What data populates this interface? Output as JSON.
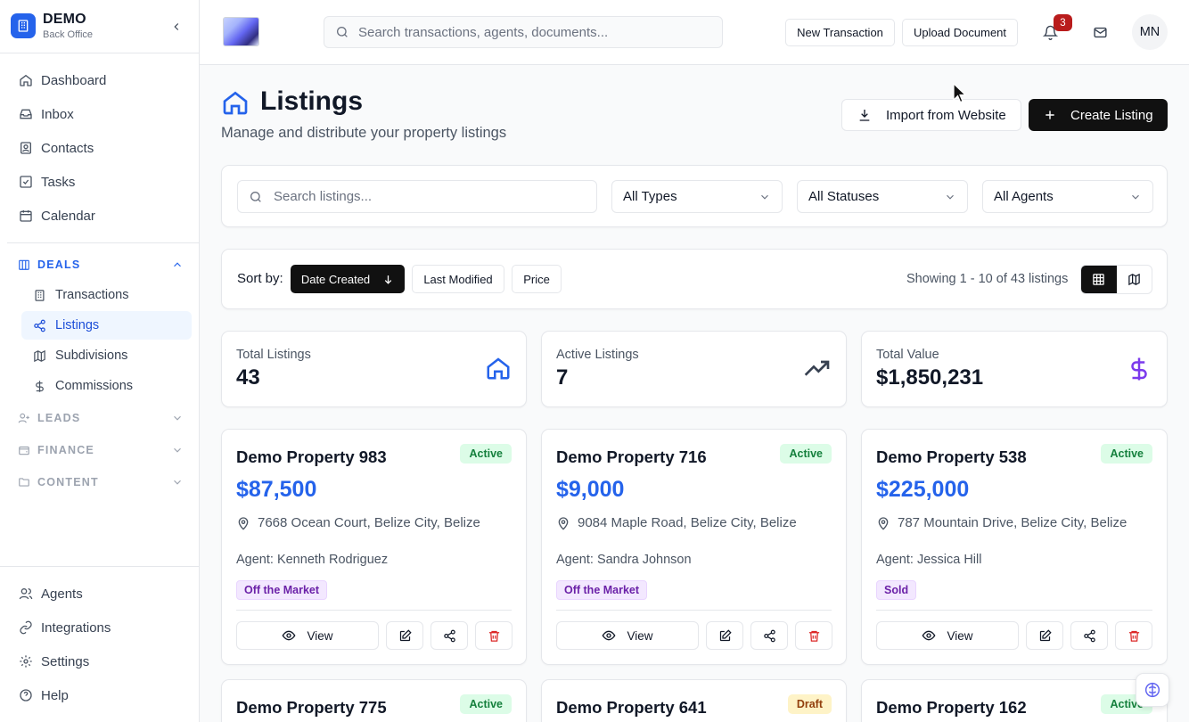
{
  "brand": {
    "name": "DEMO",
    "subtitle": "Back Office"
  },
  "nav_top": [
    {
      "label": "Dashboard",
      "icon": "home-icon"
    },
    {
      "label": "Inbox",
      "icon": "inbox-icon"
    },
    {
      "label": "Contacts",
      "icon": "contacts-icon"
    },
    {
      "label": "Tasks",
      "icon": "tasks-icon"
    },
    {
      "label": "Calendar",
      "icon": "calendar-icon"
    }
  ],
  "sections": {
    "deals": {
      "label": "DEALS",
      "expanded": true,
      "items": [
        {
          "label": "Transactions",
          "icon": "building-icon"
        },
        {
          "label": "Listings",
          "icon": "share-icon",
          "active": true
        },
        {
          "label": "Subdivisions",
          "icon": "map-icon"
        },
        {
          "label": "Commissions",
          "icon": "dollar-icon"
        }
      ]
    },
    "leads": {
      "label": "LEADS",
      "expanded": false
    },
    "finance": {
      "label": "FINANCE",
      "expanded": false
    },
    "content": {
      "label": "CONTENT",
      "expanded": false
    }
  },
  "nav_bottom": [
    {
      "label": "Agents",
      "icon": "users-icon"
    },
    {
      "label": "Integrations",
      "icon": "link-icon"
    },
    {
      "label": "Settings",
      "icon": "gear-icon"
    },
    {
      "label": "Help",
      "icon": "help-icon"
    }
  ],
  "topbar": {
    "search_placeholder": "Search transactions, agents, documents...",
    "new_transaction": "New Transaction",
    "upload_document": "Upload Document",
    "notification_count": "3",
    "avatar_initials": "MN"
  },
  "page": {
    "title": "Listings",
    "subtitle": "Manage and distribute your property listings",
    "import_label": "Import from Website",
    "create_label": "Create Listing"
  },
  "filters": {
    "search_placeholder": "Search listings...",
    "type": "All Types",
    "status": "All Statuses",
    "agent": "All Agents"
  },
  "sort": {
    "label": "Sort by:",
    "options": [
      "Date Created",
      "Last Modified",
      "Price"
    ],
    "active": "Date Created",
    "showing": "Showing 1 - 10 of 43 listings",
    "view": "grid"
  },
  "stats": [
    {
      "label": "Total Listings",
      "value": "43",
      "icon": "home-icon"
    },
    {
      "label": "Active Listings",
      "value": "7",
      "icon": "trending-up-icon"
    },
    {
      "label": "Total Value",
      "value": "$1,850,231",
      "icon": "dollar-icon"
    }
  ],
  "listings": [
    {
      "title": "Demo Property 983",
      "status": "Active",
      "price": "$87,500",
      "address": "7668 Ocean Court, Belize City, Belize",
      "agent": "Agent: Kenneth Rodriguez",
      "tag": "Off the Market",
      "view_label": "View"
    },
    {
      "title": "Demo Property 716",
      "status": "Active",
      "price": "$9,000",
      "address": "9084 Maple Road, Belize City, Belize",
      "agent": "Agent: Sandra Johnson",
      "tag": "Off the Market",
      "view_label": "View"
    },
    {
      "title": "Demo Property 538",
      "status": "Active",
      "price": "$225,000",
      "address": "787 Mountain Drive, Belize City, Belize",
      "agent": "Agent: Jessica Hill",
      "tag": "Sold",
      "view_label": "View"
    },
    {
      "title": "Demo Property 775",
      "status": "Active"
    },
    {
      "title": "Demo Property 641",
      "status": "Draft"
    },
    {
      "title": "Demo Property 162",
      "status": "Active"
    }
  ],
  "colors": {
    "accent": "#2563eb",
    "stat_value_icon": "#7c3aed",
    "trend_icon": "#374151",
    "badge_red": "#b91c1c",
    "active_green": "#15803d"
  }
}
